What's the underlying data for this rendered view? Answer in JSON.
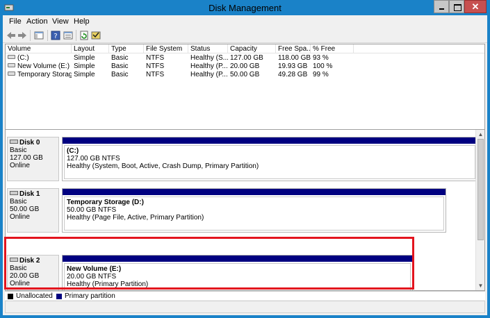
{
  "window": {
    "title": "Disk Management"
  },
  "menu": [
    "File",
    "Action",
    "View",
    "Help"
  ],
  "columns": [
    "Volume",
    "Layout",
    "Type",
    "File System",
    "Status",
    "Capacity",
    "Free Spa...",
    "% Free"
  ],
  "volumes": [
    [
      "(C:)",
      "Simple",
      "Basic",
      "NTFS",
      "Healthy (S...",
      "127.00 GB",
      "118.00 GB",
      "93 %"
    ],
    [
      "New Volume (E:)",
      "Simple",
      "Basic",
      "NTFS",
      "Healthy (P...",
      "20.00 GB",
      "19.93 GB",
      "100 %"
    ],
    [
      "Temporary Storag...",
      "Simple",
      "Basic",
      "NTFS",
      "Healthy (P...",
      "50.00 GB",
      "49.28 GB",
      "99 %"
    ]
  ],
  "disks": [
    {
      "name": "Disk 0",
      "type": "Basic",
      "size": "127.00 GB",
      "status": "Online",
      "partition": {
        "label": "(C:)",
        "size_fs": "127.00 GB NTFS",
        "health": "Healthy (System, Boot, Active, Crash Dump, Primary Partition)"
      }
    },
    {
      "name": "Disk 1",
      "type": "Basic",
      "size": "50.00 GB",
      "status": "Online",
      "partition": {
        "label": "Temporary Storage  (D:)",
        "size_fs": "50.00 GB NTFS",
        "health": "Healthy (Page File, Active, Primary Partition)"
      }
    },
    {
      "name": "Disk 2",
      "type": "Basic",
      "size": "20.00 GB",
      "status": "Online",
      "partition": {
        "label": "New Volume  (E:)",
        "size_fs": "20.00 GB NTFS",
        "health": "Healthy (Primary Partition)"
      }
    }
  ],
  "legend": [
    {
      "label": "Unallocated",
      "color": "#000000"
    },
    {
      "label": "Primary partition",
      "color": "#000080"
    }
  ],
  "colors": {
    "title_bar": "#1a82c8",
    "partition_bar": "#000080",
    "highlight": "#e3141e"
  }
}
